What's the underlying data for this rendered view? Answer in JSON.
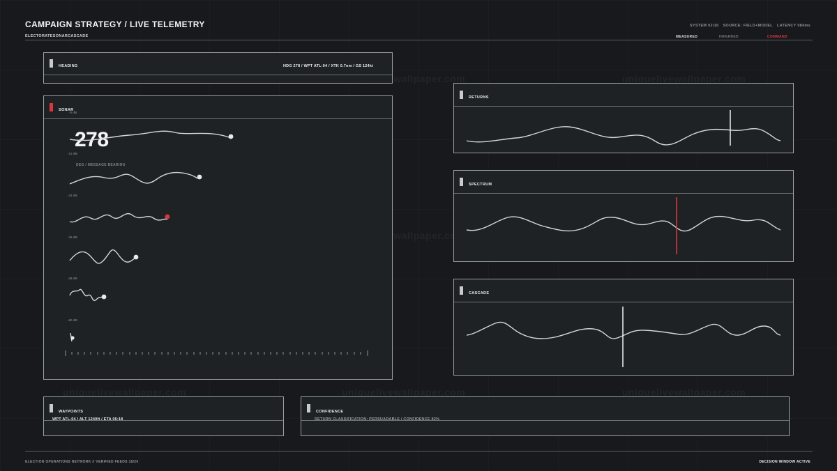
{
  "header": {
    "title": "CAMPAIGN STRATEGY / LIVE TELEMETRY",
    "subtitle": "ELECTORATESONARCASCADE",
    "meta": [
      "SYSTEM 02/16",
      "SOURCE: FIELD+MODEL",
      "LATENCY 084ms"
    ],
    "legend": {
      "measured": "MEASURED",
      "inferred": "INFERRED",
      "command": "COMMAND"
    }
  },
  "heading_panel": {
    "label": "HEADING",
    "readout": "HDG 278  /  WPT ATL-04  /  XTK 0.7nm  /  GS 124kt"
  },
  "sonar_panel": {
    "label": "SONAR",
    "big_value": "278",
    "caption": "DEG / MESSAGE BEARING",
    "ticks": [
      "-0 dB",
      "-12 dB",
      "-24 dB",
      "-36 dB",
      "-48 dB",
      "-60 dB"
    ]
  },
  "returns_panel": {
    "label": "RETURNS"
  },
  "spectrum_panel": {
    "label": "SPECTRUM"
  },
  "cascade_panel": {
    "label": "CASCADE"
  },
  "waypoints_panel": {
    "label": "WAYPOINTS",
    "readout": "WPT ATL-04  /  ALT 1240ft  /  ETA 06:18"
  },
  "confidence_panel": {
    "label": "CONFIDENCE",
    "readout": "RETURN CLASSIFICATION: PERSUADABLE / CONFIDENCE 82%"
  },
  "footer": {
    "left": "ELECTION OPERATIONS NETWORK // VERIFIED FEEDS 18/20",
    "right": "DECISION WINDOW ACTIVE"
  },
  "watermark": "uniquelivewallpaper.com",
  "colors": {
    "background": "#17191c",
    "panel": "#1f2225",
    "accent_red": "#d9373e",
    "line": "#d4d7da"
  }
}
